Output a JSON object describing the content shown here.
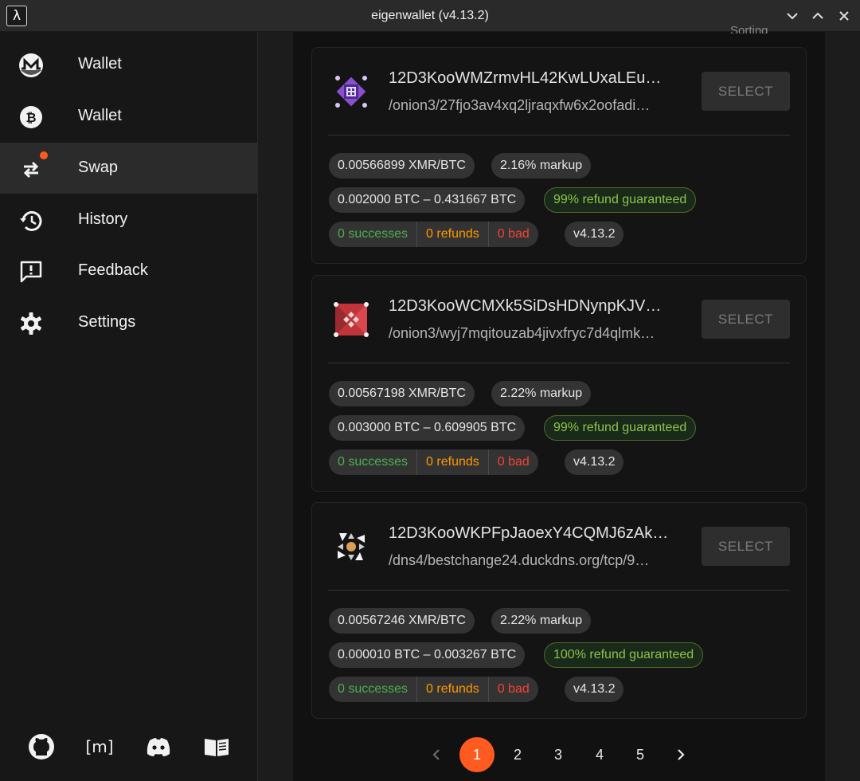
{
  "window": {
    "logo": "λ",
    "title": "eigenwallet (v4.13.2)"
  },
  "sidebar": {
    "items": [
      {
        "label": "Wallet",
        "icon": "monero-icon"
      },
      {
        "label": "Wallet",
        "icon": "bitcoin-icon"
      },
      {
        "label": "Swap",
        "icon": "swap-arrows-icon",
        "active": true,
        "notification": true
      },
      {
        "label": "History",
        "icon": "history-icon"
      },
      {
        "label": "Feedback",
        "icon": "feedback-icon"
      },
      {
        "label": "Settings",
        "icon": "gear-icon"
      }
    ],
    "footer": [
      "github-icon",
      "matrix-icon",
      "discord-icon",
      "docs-book-icon"
    ],
    "footer_matrix_text": "[m]"
  },
  "sorting_label": "Sorting",
  "makers": [
    {
      "peer_id": "12D3KooWMZrmvHL42KwLUxaLEu…",
      "address": "/onion3/27fjo3av4xq2ljraqxfw6x2oofadi…",
      "select_label": "SELECT",
      "price": "0.00566899 XMR/BTC",
      "markup": "2.16% markup",
      "range": "0.002000 BTC – 0.431667 BTC",
      "refund": "99% refund guaranteed",
      "successes": "0 successes",
      "refunds": "0 refunds",
      "bad": "0 bad",
      "version": "v4.13.2"
    },
    {
      "peer_id": "12D3KooWCMXk5SiDsHDNynpKJV…",
      "address": "/onion3/wyj7mqitouzab4jivxfryc7d4qlmk…",
      "select_label": "SELECT",
      "price": "0.00567198 XMR/BTC",
      "markup": "2.22% markup",
      "range": "0.003000 BTC – 0.609905 BTC",
      "refund": "99% refund guaranteed",
      "successes": "0 successes",
      "refunds": "0 refunds",
      "bad": "0 bad",
      "version": "v4.13.2"
    },
    {
      "peer_id": "12D3KooWKPFpJaoexY4CQMJ6zAk…",
      "address": "/dns4/bestchange24.duckdns.org/tcp/9…",
      "select_label": "SELECT",
      "price": "0.00567246 XMR/BTC",
      "markup": "2.22% markup",
      "range": "0.000010 BTC – 0.003267 BTC",
      "refund": "100% refund guaranteed",
      "successes": "0 successes",
      "refunds": "0 refunds",
      "bad": "0 bad",
      "version": "v4.13.2"
    }
  ],
  "pagination": {
    "pages": [
      "1",
      "2",
      "3",
      "4",
      "5"
    ],
    "current": "1"
  },
  "colors": {
    "accent": "#ff5a1f",
    "success": "#4caf50",
    "refund": "#ff9800",
    "bad": "#f44336",
    "guarantee": "#8ec34a"
  }
}
